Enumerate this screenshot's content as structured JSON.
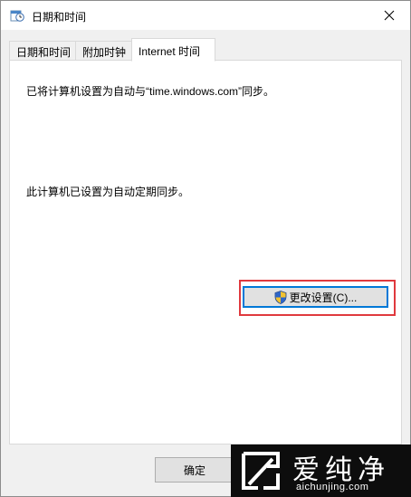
{
  "window": {
    "title": "日期和时间",
    "close_glyph": "✕"
  },
  "tabs": [
    {
      "label": "日期和时间",
      "active": false
    },
    {
      "label": "附加时钟",
      "active": false
    },
    {
      "label": "Internet 时间",
      "active": true
    }
  ],
  "internet_time": {
    "sync_message": "已将计算机设置为自动与“time.windows.com”同步。",
    "schedule_message": "此计算机已设置为自动定期同步。",
    "change_settings_label": "更改设置(C)..."
  },
  "footer": {
    "ok_label": "确定"
  },
  "watermark": {
    "brand": "爱纯净",
    "url": "aichunjing.com"
  },
  "colors": {
    "highlight": "#e0393e",
    "focus_border": "#0078d7",
    "watermark_bg": "#0d0d0d"
  },
  "icons": {
    "title": "date-time-icon",
    "close": "close-icon",
    "button": "uac-shield-icon",
    "watermark": "brand-logo-icon"
  }
}
